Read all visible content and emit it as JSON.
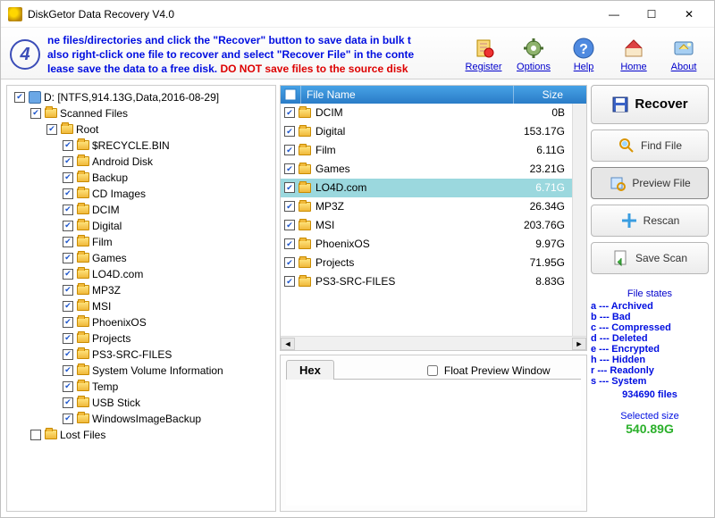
{
  "window": {
    "title": "DiskGetor Data Recovery  V4.0"
  },
  "step_number": "4",
  "hint": {
    "l1": "ne files/directories and click the \"Recover\" button to save data in bulk t",
    "l2": "also right-click one file to recover and select \"Recover File\" in the conte",
    "l3a": "lease save the data to a free disk. ",
    "l3b": "DO NOT save files to the source disk"
  },
  "toolbar": {
    "register": "Register",
    "options": "Options",
    "help": "Help",
    "home": "Home",
    "about": "About"
  },
  "tree": [
    {
      "depth": 0,
      "cb": true,
      "icon": "drive",
      "label": "D: [NTFS,914.13G,Data,2016-08-29]"
    },
    {
      "depth": 1,
      "cb": true,
      "icon": "folder",
      "label": "Scanned Files"
    },
    {
      "depth": 2,
      "cb": true,
      "icon": "folder",
      "label": "Root"
    },
    {
      "depth": 3,
      "cb": true,
      "icon": "folder",
      "label": "$RECYCLE.BIN"
    },
    {
      "depth": 3,
      "cb": true,
      "icon": "folder",
      "label": "Android Disk"
    },
    {
      "depth": 3,
      "cb": true,
      "icon": "folder",
      "label": "Backup"
    },
    {
      "depth": 3,
      "cb": true,
      "icon": "folder",
      "label": "CD Images"
    },
    {
      "depth": 3,
      "cb": true,
      "icon": "folder",
      "label": "DCIM"
    },
    {
      "depth": 3,
      "cb": true,
      "icon": "folder",
      "label": "Digital"
    },
    {
      "depth": 3,
      "cb": true,
      "icon": "folder",
      "label": "Film"
    },
    {
      "depth": 3,
      "cb": true,
      "icon": "folder",
      "label": "Games"
    },
    {
      "depth": 3,
      "cb": true,
      "icon": "folder",
      "label": "LO4D.com"
    },
    {
      "depth": 3,
      "cb": true,
      "icon": "folder",
      "label": "MP3Z"
    },
    {
      "depth": 3,
      "cb": true,
      "icon": "folder",
      "label": "MSI"
    },
    {
      "depth": 3,
      "cb": true,
      "icon": "folder",
      "label": "PhoenixOS"
    },
    {
      "depth": 3,
      "cb": true,
      "icon": "folder",
      "label": "Projects"
    },
    {
      "depth": 3,
      "cb": true,
      "icon": "folder",
      "label": "PS3-SRC-FILES"
    },
    {
      "depth": 3,
      "cb": true,
      "icon": "folder",
      "label": "System Volume Information"
    },
    {
      "depth": 3,
      "cb": true,
      "icon": "folder",
      "label": "Temp"
    },
    {
      "depth": 3,
      "cb": true,
      "icon": "folder",
      "label": "USB Stick"
    },
    {
      "depth": 3,
      "cb": true,
      "icon": "folder",
      "label": "WindowsImageBackup"
    },
    {
      "depth": 1,
      "cb": false,
      "icon": "folder",
      "label": "Lost Files"
    }
  ],
  "file_list": {
    "col_name": "File Name",
    "col_size": "Size",
    "rows": [
      {
        "name": "DCIM",
        "size": "0B",
        "sel": false
      },
      {
        "name": "Digital",
        "size": "153.17G",
        "sel": false
      },
      {
        "name": "Film",
        "size": "6.11G",
        "sel": false
      },
      {
        "name": "Games",
        "size": "23.21G",
        "sel": false
      },
      {
        "name": "LO4D.com",
        "size": "6.71G",
        "sel": true
      },
      {
        "name": "MP3Z",
        "size": "26.34G",
        "sel": false
      },
      {
        "name": "MSI",
        "size": "203.76G",
        "sel": false
      },
      {
        "name": "PhoenixOS",
        "size": "9.97G",
        "sel": false
      },
      {
        "name": "Projects",
        "size": "71.95G",
        "sel": false
      },
      {
        "name": "PS3-SRC-FILES",
        "size": "8.83G",
        "sel": false
      }
    ]
  },
  "preview": {
    "tab": "Hex",
    "float_label": "Float Preview Window"
  },
  "actions": {
    "recover": "Recover",
    "find": "Find File",
    "preview": "Preview File",
    "rescan": "Rescan",
    "save": "Save Scan"
  },
  "states": {
    "header": "File states",
    "items": [
      {
        "k": "a",
        "v": "Archived"
      },
      {
        "k": "b",
        "v": "Bad"
      },
      {
        "k": "c",
        "v": "Compressed"
      },
      {
        "k": "d",
        "v": "Deleted"
      },
      {
        "k": "e",
        "v": "Encrypted"
      },
      {
        "k": "h",
        "v": "Hidden"
      },
      {
        "k": "r",
        "v": "Readonly"
      },
      {
        "k": "s",
        "v": "System"
      }
    ],
    "count": "934690 files"
  },
  "selected": {
    "label": "Selected size",
    "value": "540.89G"
  }
}
